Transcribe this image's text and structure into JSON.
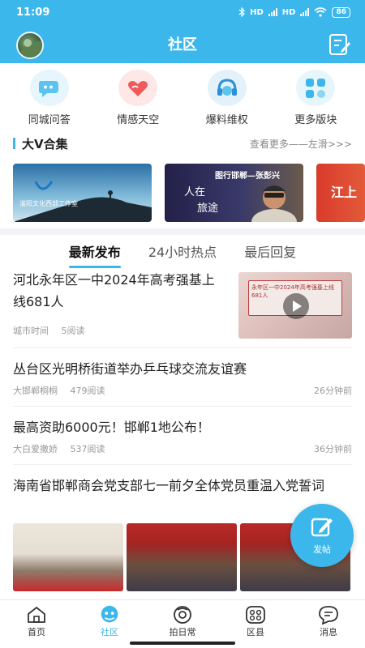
{
  "status": {
    "time": "11:09",
    "battery": "86",
    "net1": "HD",
    "net2": "HD"
  },
  "header": {
    "title": "社区"
  },
  "categories": [
    {
      "label": "同城问答",
      "icon": "qa-bubble-icon",
      "color": "#5bc3ef"
    },
    {
      "label": "情感天空",
      "icon": "heart-hands-icon",
      "color": "#f05a5a"
    },
    {
      "label": "爆料维权",
      "icon": "headset-icon",
      "color": "#2b8fd9"
    },
    {
      "label": "更多版块",
      "icon": "more-blocks-icon",
      "color": "#3cb7ec"
    }
  ],
  "bigv": {
    "title": "大V合集",
    "more": "查看更多——左滑>>>",
    "banners": [
      {
        "caption": "滏阳文化西部工作室"
      },
      {
        "caption": "图行邯郸—张彭兴",
        "sub1": "人在",
        "sub2": "旅途"
      },
      {
        "caption": "江上"
      }
    ]
  },
  "tabs": [
    "最新发布",
    "24小时热点",
    "最后回复"
  ],
  "feed": [
    {
      "title": "河北永年区一中2024年高考强基上线681人",
      "source": "城市时间",
      "reads": "5阅读",
      "thumb_text": "永年区一中2024年高考强基上线681人"
    },
    {
      "title": "丛台区光明桥街道举办乒乓球交流友谊赛",
      "source": "大邯郸桐桐",
      "reads": "479阅读",
      "time": "26分钟前"
    },
    {
      "title": "最高资助6000元！邯郸1地公布！",
      "source": "大白爱撒娇",
      "reads": "537阅读",
      "time": "36分钟前"
    },
    {
      "title": "海南省邯郸商会党支部七一前夕全体党员重温入党誓词"
    }
  ],
  "fab": {
    "label": "发帖"
  },
  "nav": [
    {
      "label": "首页",
      "icon": "home-icon"
    },
    {
      "label": "社区",
      "icon": "community-icon"
    },
    {
      "label": "拍日常",
      "icon": "camera-icon"
    },
    {
      "label": "区县",
      "icon": "districts-icon"
    },
    {
      "label": "消息",
      "icon": "message-icon"
    }
  ],
  "colors": {
    "accent": "#3cb7ec"
  }
}
